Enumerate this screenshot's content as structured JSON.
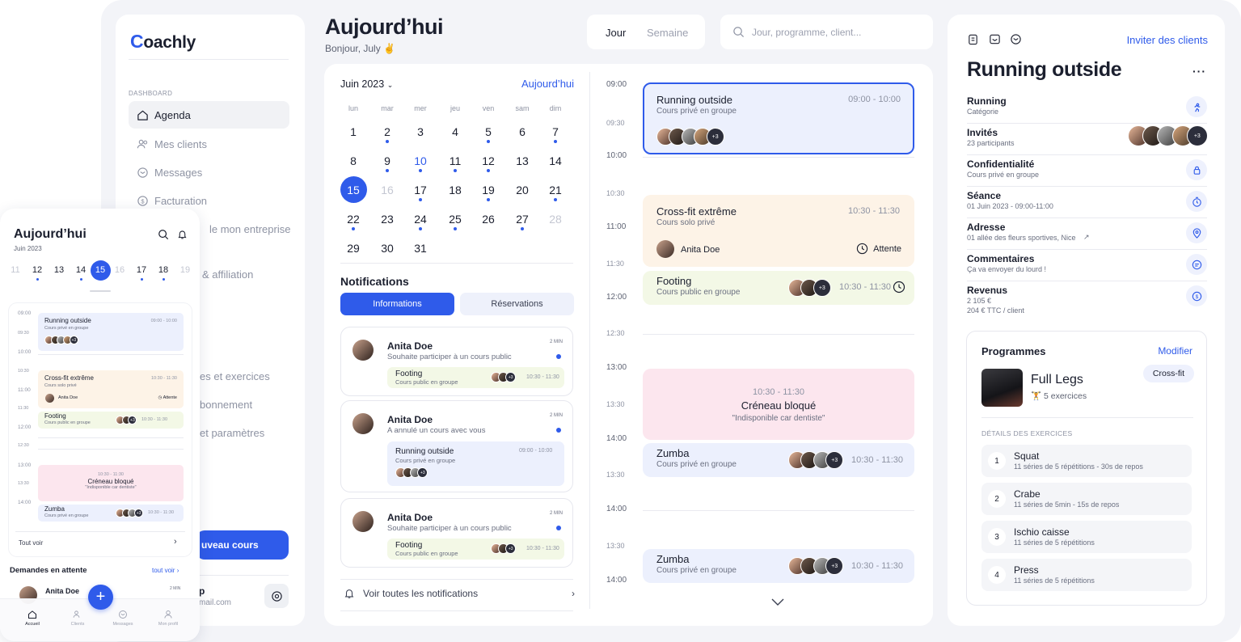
{
  "sidebar": {
    "logo_c": "C",
    "logo_rest": "oachly",
    "section": "DASHBOARD",
    "items": [
      {
        "label": "Agenda",
        "icon": "home-icon"
      },
      {
        "label": "Mes clients",
        "icon": "users-icon"
      },
      {
        "label": "Messages",
        "icon": "message-icon"
      },
      {
        "label": "Facturation",
        "icon": "dollar-icon"
      },
      {
        "label": "le mon entreprise"
      },
      {
        "label": "& affiliation"
      },
      {
        "label": "es et exercices"
      },
      {
        "label": "bonnement"
      },
      {
        "label": "et paramètres"
      }
    ],
    "new_button": "uveau cours",
    "user_name_fragment": "p",
    "user_email_fragment": "mail.com"
  },
  "header": {
    "title": "Aujourd’hui",
    "greeting": "Bonjour, July ✌️",
    "toggle": [
      "Jour",
      "Semaine"
    ],
    "search_placeholder": "Jour, programme, client..."
  },
  "calendar": {
    "month": "Juin 2023",
    "today_link": "Aujourd’hui",
    "dow": [
      "lun",
      "mar",
      "mer",
      "jeu",
      "ven",
      "sam",
      "dim"
    ],
    "weeks": [
      [
        "1",
        "2",
        "3",
        "4",
        "5",
        "6",
        "7"
      ],
      [
        "8",
        "9",
        "10",
        "11",
        "12",
        "13",
        "14"
      ],
      [
        "15",
        "16",
        "17",
        "18",
        "19",
        "20",
        "21"
      ],
      [
        "22",
        "23",
        "24",
        "25",
        "26",
        "27",
        "28"
      ],
      [
        "29",
        "30",
        "31"
      ]
    ]
  },
  "notifications": {
    "title": "Notifications",
    "tabs": [
      "Informations",
      "Réservations"
    ],
    "items": [
      {
        "name": "Anita Doe",
        "text": "Souhaite participer à un cours public",
        "time": "2 MIN",
        "event": "Footing",
        "event_sub": "Cours public en groupe",
        "event_time": "10:30 - 11:30"
      },
      {
        "name": "Anita Doe",
        "text": "A annulé un cours avec vous",
        "time": "2 MIN",
        "event": "Running outside",
        "event_sub": "Cours privé en groupe",
        "event_time": "09:00 - 10:00"
      },
      {
        "name": "Anita Doe",
        "text": "Souhaite participer à un cours public",
        "time": "2 MIN",
        "event": "Footing",
        "event_sub": "Cours public en groupe",
        "event_time": "10:30 - 11:30"
      }
    ],
    "see_all": "Voir toutes les notifications",
    "plus3": "+3"
  },
  "timeline": {
    "times": [
      "09:00",
      "09:30",
      "10:00",
      "10:30",
      "11:00",
      "11:30",
      "12:00",
      "12:30",
      "13:00",
      "13:30",
      "14:00",
      "13:30",
      "14:00",
      "13:30",
      "14:00"
    ],
    "events": {
      "running": {
        "title": "Running outside",
        "sub": "Cours privé en groupe",
        "time": "09:00 - 10:00"
      },
      "crossfit": {
        "title": "Cross-fit extrême",
        "sub": "Cours solo privé",
        "time": "10:30 - 11:30",
        "person": "Anita Doe",
        "status": "Attente"
      },
      "footing": {
        "title": "Footing",
        "sub": "Cours public en groupe",
        "time": "10:30 - 11:30"
      },
      "blocked": {
        "time": "10:30 - 11:30",
        "title": "Créneau bloqué",
        "sub": "\"Indisponible car dentiste\""
      },
      "zumba1": {
        "title": "Zumba",
        "sub": "Cours privé en groupe",
        "time": "10:30 - 11:30"
      },
      "zumba2": {
        "title": "Zumba",
        "sub": "Cours privé en groupe",
        "time": "10:30 - 11:30"
      }
    }
  },
  "detail": {
    "invite": "Inviter des clients",
    "title": "Running outside",
    "props": [
      {
        "title": "Running",
        "sub": "Catégorie",
        "icon": "runner-icon"
      },
      {
        "title": "Invités",
        "sub": "23 participants",
        "icon": "avatars"
      },
      {
        "title": "Confidentialité",
        "sub": "Cours privé en groupe",
        "icon": "lock-icon"
      },
      {
        "title": "Séance",
        "sub": "01 Juin 2023 - 09:00-11:00",
        "icon": "timer-icon"
      },
      {
        "title": "Adresse",
        "sub": "01 allée des fleurs sportives, Nice",
        "icon": "location-icon"
      },
      {
        "title": "Commentaires",
        "sub": "Ça va envoyer du lourd !",
        "icon": "comment-icon"
      },
      {
        "title": "Revenus",
        "sub": "2 105 €",
        "sub2": "204 € TTC / client",
        "icon": "dollar-icon"
      }
    ],
    "programmes": {
      "title": "Programmes",
      "edit": "Modifier",
      "name": "Full Legs",
      "count": "5 exercices",
      "tag": "Cross-fit",
      "details_label": "DÉTAILS DES EXERCICES",
      "exercises": [
        {
          "n": "1",
          "title": "Squat",
          "sub": "11 séries de 5 répétitions - 30s de repos"
        },
        {
          "n": "2",
          "title": "Crabe",
          "sub": "11 séries de 5min - 15s de repos"
        },
        {
          "n": "3",
          "title": "Ischio caisse",
          "sub": "11 séries de 5 répétitions"
        },
        {
          "n": "4",
          "title": "Press",
          "sub": "11 séries de 5 répétitions"
        }
      ]
    }
  },
  "mobile": {
    "title": "Aujourd’hui",
    "month": "Juin 2023",
    "dates": [
      "11",
      "12",
      "13",
      "14",
      "15",
      "16",
      "17",
      "18",
      "19"
    ],
    "times": [
      "09:00",
      "09:30",
      "10:00",
      "10:30",
      "11:00",
      "11:30",
      "12:00",
      "12:30",
      "13:00",
      "13:30",
      "14:00"
    ],
    "events": {
      "running": {
        "title": "Running outside",
        "sub": "Cours privé en groupe",
        "time": "09:00 - 10:00"
      },
      "crossfit": {
        "title": "Cross-fit extrême",
        "sub": "Cours solo privé",
        "time": "10:30 - 11:30",
        "person": "Anita Doe",
        "status": "Attente"
      },
      "footing": {
        "title": "Footing",
        "sub": "Cours public en groupe",
        "time": "10:30 - 11:30"
      },
      "blocked": {
        "time": "10:30 - 11:30",
        "title": "Créneau bloqué",
        "sub": "\"Indisponible car dentiste\""
      },
      "zumba": {
        "title": "Zumba",
        "sub": "Cours privé en groupe",
        "time": "10:30 - 11:30"
      }
    },
    "see_all": "Tout voir",
    "pending_title": "Demandes en attente",
    "pending_link": "tout voir",
    "pending_name": "Anita Doe",
    "pending_time": "2 MIN",
    "tabs": [
      "Accueil",
      "Clients",
      "Messages",
      "Mon profil"
    ],
    "fab": "+"
  },
  "colors": {
    "accent": "#2f5bea",
    "event_blue": "#ecf0fd",
    "event_orange": "#fdf3e7",
    "event_green": "#f3f8e6",
    "event_pink": "#fce6ee"
  }
}
